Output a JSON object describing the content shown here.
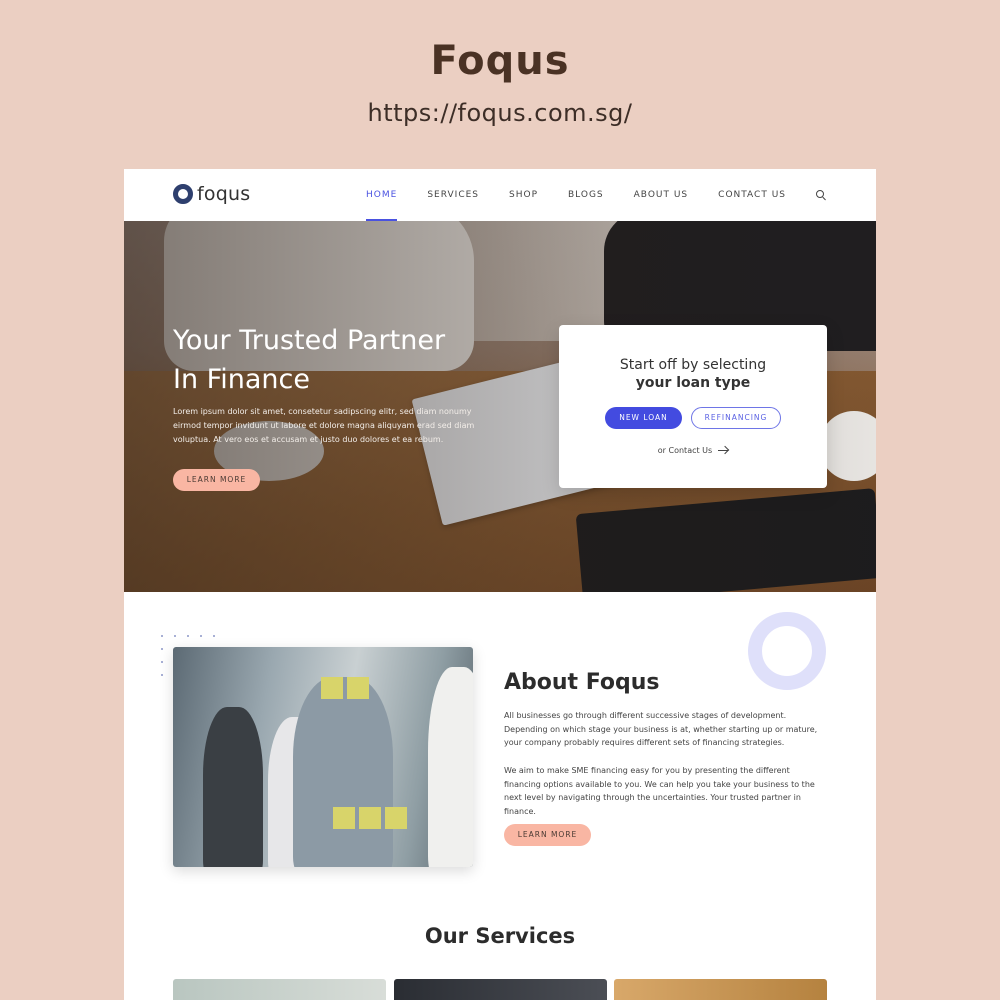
{
  "showcase": {
    "title": "Foqus",
    "url": "https://foqus.com.sg/"
  },
  "nav": {
    "logo_text": "foqus",
    "items": [
      "HOME",
      "SERVICES",
      "SHOP",
      "BLOGS",
      "ABOUT US",
      "CONTACT US"
    ],
    "active_index": 0
  },
  "hero": {
    "title_line1": "Your Trusted Partner",
    "title_line2": "In Finance",
    "text": "Lorem ipsum dolor sit amet, consetetur sadipscing elitr, sed diam nonumy eirmod tempor invidunt ut labore et dolore magna aliquyam erad sed diam voluptua. At vero eos et accusam et justo duo dolores et ea rebum.",
    "button": "LEARN MORE"
  },
  "loan_card": {
    "line1": "Start off by selecting",
    "line2": "your loan type",
    "primary_button": "NEW LOAN",
    "secondary_button": "REFINANCING",
    "contact_link": "or Contact Us"
  },
  "about": {
    "title": "About Foqus",
    "para1": "All businesses go through different successive stages of development. Depending on which stage your business is at, whether starting up or mature, your company probably requires different sets of financing strategies.",
    "para2": "We aim to make SME financing easy for you by presenting the different financing options available to you. We can help you take your business to the next level by navigating through the uncertainties. Your trusted partner in finance.",
    "button": "LEARN MORE"
  },
  "services": {
    "title": "Our Services"
  },
  "colors": {
    "accent_blue": "#434be0",
    "peach": "#f9b6a3",
    "background": "#ebcfc2"
  }
}
